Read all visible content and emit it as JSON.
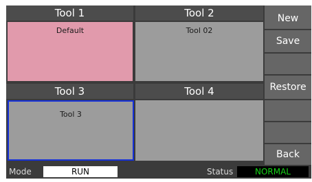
{
  "tools": [
    {
      "header": "Tool 1",
      "content": "Default",
      "bg": "#e19aac"
    },
    {
      "header": "Tool 2",
      "content": "Tool 02",
      "bg": "#9c9c9c"
    },
    {
      "header": "Tool 3",
      "content": "Tool 3",
      "bg": "#9c9c9c",
      "border": "#1530d8"
    },
    {
      "header": "Tool 4",
      "content": "",
      "bg": "#9c9c9c"
    }
  ],
  "sidebar": {
    "new_label": "New",
    "save_label": "Save",
    "restore_label": "Restore",
    "back_label": "Back"
  },
  "status_bar": {
    "mode_label": "Mode",
    "mode_value": "RUN",
    "status_label": "Status",
    "status_value": "NORMAL",
    "status_color": "#16d416"
  }
}
